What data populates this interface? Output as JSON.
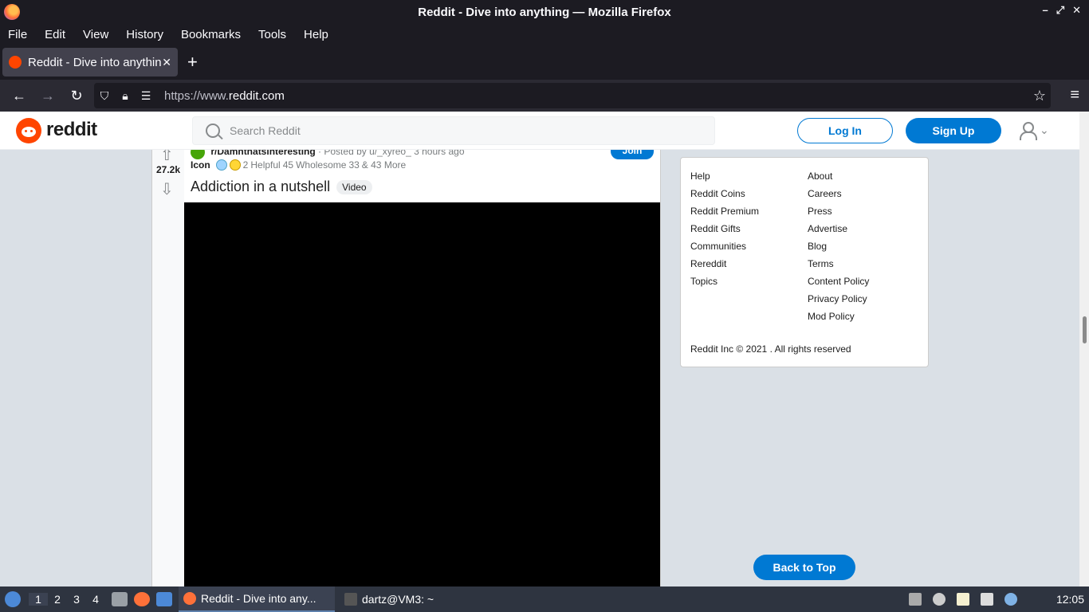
{
  "window": {
    "title": "Reddit - Dive into anything — Mozilla Firefox",
    "controls": [
      "–",
      "⤢",
      "✕"
    ]
  },
  "menubar": [
    "File",
    "Edit",
    "View",
    "History",
    "Bookmarks",
    "Tools",
    "Help"
  ],
  "tab": {
    "label": "Reddit - Dive into anything",
    "close": "✕",
    "new_tab": "+"
  },
  "navbar": {
    "url_prefix": "https://www.",
    "url_domain": "reddit.com"
  },
  "reddit": {
    "wordmark": "reddit",
    "search_placeholder": "Search Reddit",
    "login": "Log In",
    "signup": "Sign Up"
  },
  "post": {
    "score": "27.2k",
    "subreddit": "r/Damnthatsinteresting",
    "posted_by": "· Posted by u/_xyreo_ 3 hours ago",
    "join": "Join",
    "icon_label": "Icon",
    "awards": {
      "helpful_count": "2",
      "helpful_label": "Helpful",
      "wholesome_count": "45",
      "wholesome_label": "Wholesome",
      "more_count": "33",
      "more_label": "& 43 More"
    },
    "title": "Addiction in a nutshell",
    "flair": "Video"
  },
  "footer": {
    "col1": [
      "Help",
      "Reddit Coins",
      "Reddit Premium",
      "Reddit Gifts",
      "Communities",
      "Rereddit",
      "Topics"
    ],
    "col2": [
      "About",
      "Careers",
      "Press",
      "Advertise",
      "Blog",
      "Terms",
      "Content Policy",
      "Privacy Policy",
      "Mod Policy"
    ],
    "copyright": "Reddit Inc © 2021 . All rights reserved"
  },
  "back_to_top": "Back to Top",
  "taskbar": {
    "workspaces": [
      "1",
      "2",
      "3",
      "4"
    ],
    "task_firefox": "Reddit - Dive into any...",
    "task_terminal": "dartz@VM3: ~",
    "clock": "12:05"
  },
  "colors": {
    "reddit_orange": "#ff4500",
    "reddit_blue": "#0079d3",
    "page_bg": "#dae0e6"
  }
}
